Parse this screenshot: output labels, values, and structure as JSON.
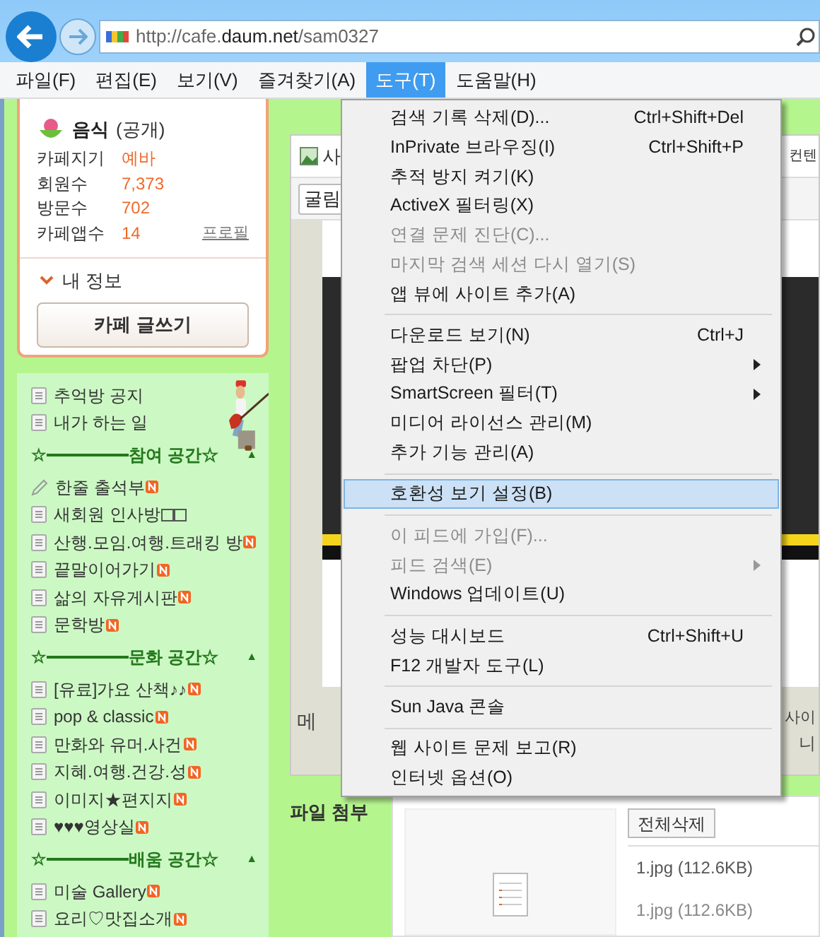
{
  "browser": {
    "url": "http://cafe.**daum.net**/sam0327"
  },
  "menu_bar": [
    {
      "label": "파일(F)",
      "selected": false
    },
    {
      "label": "편집(E)",
      "selected": false
    },
    {
      "label": "보기(V)",
      "selected": false
    },
    {
      "label": "즐겨찾기(A)",
      "selected": false
    },
    {
      "label": "도구(T)",
      "selected": true
    },
    {
      "label": "도움말(H)",
      "selected": false
    }
  ],
  "tools_menu": [
    {
      "kind": "item",
      "label": "검색 기록 삭제(D)...",
      "shortcut": "Ctrl+Shift+Del",
      "disabled": false,
      "submenu": false,
      "selected": false
    },
    {
      "kind": "item",
      "label": "InPrivate 브라우징(I)",
      "shortcut": "Ctrl+Shift+P",
      "disabled": false,
      "submenu": false,
      "selected": false
    },
    {
      "kind": "item",
      "label": "추적 방지 켜기(K)",
      "disabled": false,
      "submenu": false,
      "selected": false
    },
    {
      "kind": "item",
      "label": "ActiveX 필터링(X)",
      "disabled": false,
      "submenu": false,
      "selected": false
    },
    {
      "kind": "item",
      "label": "연결 문제 진단(C)...",
      "disabled": true,
      "submenu": false,
      "selected": false
    },
    {
      "kind": "item",
      "label": "마지막 검색 세션 다시 열기(S)",
      "disabled": true,
      "submenu": false,
      "selected": false
    },
    {
      "kind": "item",
      "label": "앱 뷰에 사이트 추가(A)",
      "disabled": false,
      "submenu": false,
      "selected": false
    },
    {
      "kind": "separator"
    },
    {
      "kind": "item",
      "label": "다운로드 보기(N)",
      "shortcut": "Ctrl+J",
      "disabled": false,
      "submenu": false,
      "selected": false
    },
    {
      "kind": "item",
      "label": "팝업 차단(P)",
      "disabled": false,
      "submenu": true,
      "selected": false
    },
    {
      "kind": "item",
      "label": "SmartScreen 필터(T)",
      "disabled": false,
      "submenu": true,
      "selected": false
    },
    {
      "kind": "item",
      "label": "미디어 라이선스 관리(M)",
      "disabled": false,
      "submenu": false,
      "selected": false
    },
    {
      "kind": "item",
      "label": "추가 기능 관리(A)",
      "disabled": false,
      "submenu": false,
      "selected": false
    },
    {
      "kind": "separator"
    },
    {
      "kind": "item",
      "label": "호환성 보기 설정(B)",
      "disabled": false,
      "submenu": false,
      "selected": true
    },
    {
      "kind": "separator"
    },
    {
      "kind": "item",
      "label": "이 피드에 가입(F)...",
      "disabled": true,
      "submenu": false,
      "selected": false
    },
    {
      "kind": "item",
      "label": "피드 검색(E)",
      "disabled": true,
      "submenu": true,
      "selected": false
    },
    {
      "kind": "item",
      "label": "Windows 업데이트(U)",
      "disabled": false,
      "submenu": false,
      "selected": false
    },
    {
      "kind": "separator"
    },
    {
      "kind": "item",
      "label": "성능 대시보드",
      "shortcut": "Ctrl+Shift+U",
      "disabled": false,
      "submenu": false,
      "selected": false
    },
    {
      "kind": "item",
      "label": "F12 개발자 도구(L)",
      "disabled": false,
      "submenu": false,
      "selected": false
    },
    {
      "kind": "separator"
    },
    {
      "kind": "item",
      "label": "Sun Java 콘솔",
      "disabled": false,
      "submenu": false,
      "selected": false
    },
    {
      "kind": "separator"
    },
    {
      "kind": "item",
      "label": "웹 사이트 문제 보고(R)",
      "disabled": false,
      "submenu": false,
      "selected": false
    },
    {
      "kind": "item",
      "label": "인터넷 옵션(O)",
      "disabled": false,
      "submenu": false,
      "selected": false
    }
  ],
  "cafe_info": {
    "title": "음식",
    "visibility": "(공개)",
    "stats": [
      {
        "label": "카페지기",
        "value": "예바"
      },
      {
        "label": "회원수",
        "value": "7,373"
      },
      {
        "label": "방문수",
        "value": "702"
      },
      {
        "label": "카페앱수",
        "value": "14"
      }
    ],
    "profile_link": "프로필",
    "my_info": "내 정보",
    "write_button": "카페 글쓰기"
  },
  "boards": [
    {
      "kind": "board",
      "label": "추억방 공지"
    },
    {
      "kind": "board",
      "label": "내가 하는 일"
    },
    {
      "kind": "header",
      "label": "참여 공간☆",
      "star": "☆",
      "toggle": "▲"
    },
    {
      "kind": "attendance",
      "label": "한줄 출석부",
      "new": true
    },
    {
      "kind": "board",
      "label": "새회원 인사방",
      "emoticon": true
    },
    {
      "kind": "board",
      "label": "산행.모임.여행.트래킹 방",
      "new": true
    },
    {
      "kind": "board",
      "label": "끝말이어가기",
      "new": true
    },
    {
      "kind": "board",
      "label": "삶의 자유게시판",
      "new": true
    },
    {
      "kind": "board",
      "label": "문학방",
      "new": true
    },
    {
      "kind": "header",
      "label": "문화 공간☆",
      "star": "☆",
      "toggle": "▲"
    },
    {
      "kind": "board",
      "label": "[유료]가요 산책♪♪",
      "new": true
    },
    {
      "kind": "board",
      "label": "pop & classic",
      "new": true
    },
    {
      "kind": "board",
      "label": "만화와 유머.사건",
      "new": true
    },
    {
      "kind": "board",
      "label": "지혜.여행.건강.성",
      "new": true
    },
    {
      "kind": "board",
      "label": "이미지★편지지",
      "new": true
    },
    {
      "kind": "board",
      "label": "♥♥♥영상실",
      "new": true
    },
    {
      "kind": "header",
      "label": "배움 공간☆",
      "star": "☆",
      "toggle": "▲"
    },
    {
      "kind": "board",
      "label": "미술 Gallery",
      "new": true
    },
    {
      "kind": "board",
      "label": "요리♡맛집소개",
      "new": true
    }
  ],
  "editor": {
    "tab_left": "사",
    "tab_right": "컨텐",
    "font_select": "굴림",
    "text_left_1": "메",
    "text_right_1": "사이",
    "text_right_2": "니"
  },
  "attachments": {
    "label": "파일 첨부",
    "delete_all_button": "전체삭제",
    "files": [
      "1.jpg (112.6KB)",
      "1.jpg (112.6KB)"
    ]
  }
}
